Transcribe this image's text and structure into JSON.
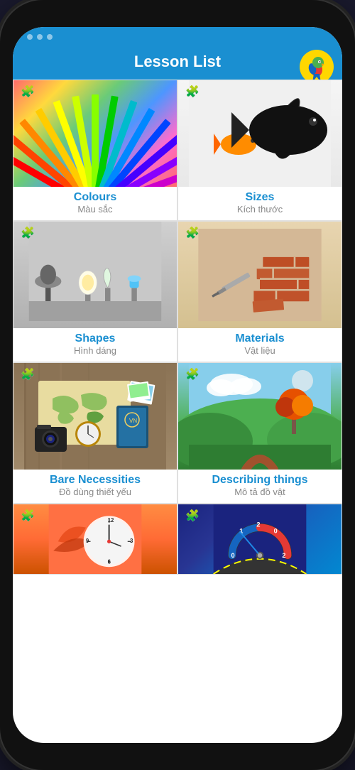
{
  "app": {
    "title": "Lesson List",
    "logoEmoji": "🦜"
  },
  "header": {
    "background": "#1a8fd1"
  },
  "lessons": [
    {
      "id": "colours",
      "title": "Colours",
      "subtitle": "Màu sắc",
      "imageType": "colours"
    },
    {
      "id": "sizes",
      "title": "Sizes",
      "subtitle": "Kích thước",
      "imageType": "sizes"
    },
    {
      "id": "shapes",
      "title": "Shapes",
      "subtitle": "Hình dáng",
      "imageType": "shapes"
    },
    {
      "id": "materials",
      "title": "Materials",
      "subtitle": "Vật liệu",
      "imageType": "materials"
    },
    {
      "id": "bare-necessities",
      "title": "Bare Necessities",
      "subtitle": "Đồ dùng thiết yếu",
      "imageType": "bare"
    },
    {
      "id": "describing-things",
      "title": "Describing things",
      "subtitle": "Mô tả đồ vật",
      "imageType": "describing"
    },
    {
      "id": "lesson7",
      "title": "",
      "subtitle": "",
      "imageType": "clock1"
    },
    {
      "id": "lesson8",
      "title": "",
      "subtitle": "",
      "imageType": "clock2"
    }
  ],
  "pencilColors": [
    "#ff0000",
    "#ff4400",
    "#ff8800",
    "#ffcc00",
    "#ffee00",
    "#ccff00",
    "#88ff00",
    "#44cc00",
    "#00bb00",
    "#009944",
    "#006699",
    "#0033cc",
    "#3300cc",
    "#6600cc",
    "#9900cc",
    "#cc00bb",
    "#ff0099",
    "#ff0055"
  ]
}
